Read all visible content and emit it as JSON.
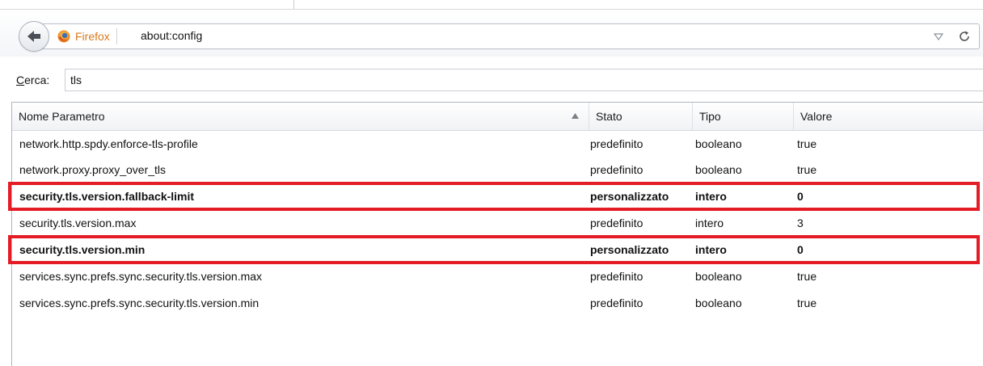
{
  "browser": {
    "identity_label": "Firefox",
    "url": "about:config"
  },
  "search": {
    "label_accesskey": "C",
    "label_rest": "erca:",
    "value": "tls"
  },
  "table": {
    "columns": [
      "Nome Parametro",
      "Stato",
      "Tipo",
      "Valore"
    ],
    "sort_column": "Nome Parametro",
    "rows": [
      {
        "name": "network.http.spdy.enforce-tls-profile",
        "status": "predefinito",
        "type": "booleano",
        "value": "true",
        "modified": false
      },
      {
        "name": "network.proxy.proxy_over_tls",
        "status": "predefinito",
        "type": "booleano",
        "value": "true",
        "modified": false
      },
      {
        "name": "security.tls.version.fallback-limit",
        "status": "personalizzato",
        "type": "intero",
        "value": "0",
        "modified": true,
        "highlighted": true
      },
      {
        "name": "security.tls.version.max",
        "status": "predefinito",
        "type": "intero",
        "value": "3",
        "modified": false
      },
      {
        "name": "security.tls.version.min",
        "status": "personalizzato",
        "type": "intero",
        "value": "0",
        "modified": true,
        "highlighted": true
      },
      {
        "name": "services.sync.prefs.sync.security.tls.version.max",
        "status": "predefinito",
        "type": "booleano",
        "value": "true",
        "modified": false
      },
      {
        "name": "services.sync.prefs.sync.security.tls.version.min",
        "status": "predefinito",
        "type": "booleano",
        "value": "true",
        "modified": false
      }
    ]
  },
  "icons": {
    "back": "back-arrow-icon",
    "logo": "firefox-logo-icon",
    "dropmarker": "history-dropmarker-icon",
    "reload": "reload-icon",
    "sort": "sort-ascending-icon"
  },
  "colors": {
    "highlight": "#e31c25",
    "identity": "#d97a1c"
  }
}
